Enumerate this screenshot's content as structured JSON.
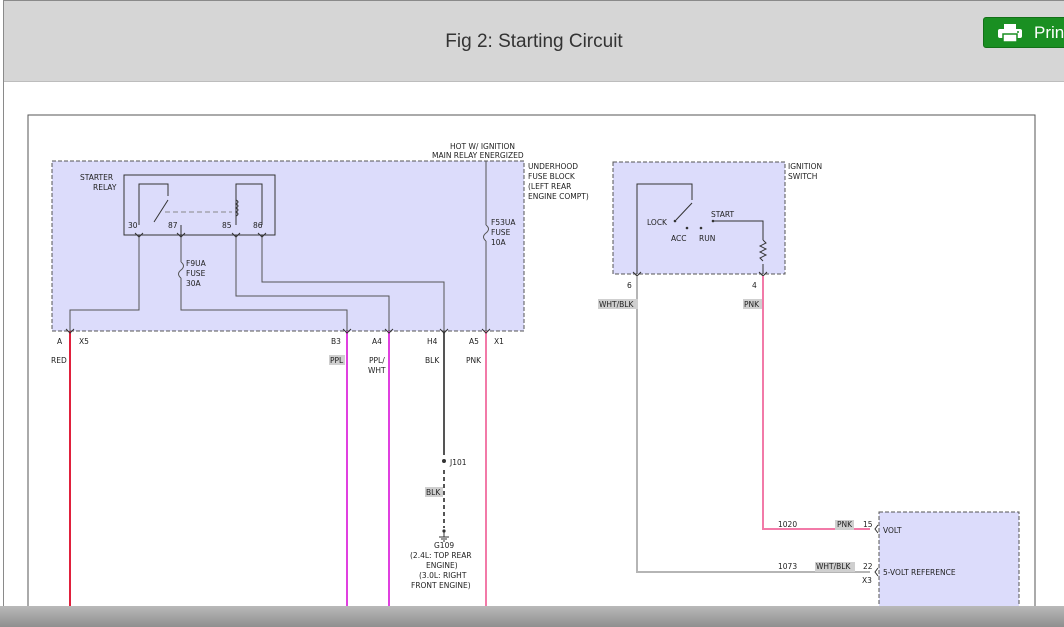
{
  "header": {
    "title": "Fig 2: Starting Circuit",
    "print_label": "Print"
  },
  "diagram": {
    "hot_label_1": "HOT W/ IGNITION",
    "hot_label_2": "MAIN RELAY ENERGIZED",
    "fuse_block": [
      "UNDERHOOD",
      "FUSE BLOCK",
      "(LEFT REAR",
      "ENGINE COMPT)"
    ],
    "starter_relay": [
      "STARTER",
      "RELAY"
    ],
    "relay_pins": [
      "30",
      "87",
      "85",
      "86"
    ],
    "fuse_f53": [
      "F53UA",
      "FUSE",
      "10A"
    ],
    "fuse_f9": [
      "F9UA",
      "FUSE",
      "30A"
    ],
    "connectors": {
      "a": "A",
      "x5": "X5",
      "b3": "B3",
      "a4": "A4",
      "h4": "H4",
      "a5": "A5",
      "x1": "X1"
    },
    "wire_colors": {
      "red": "RED",
      "ppl": "PPL",
      "ppl_wht_1": "PPL/",
      "ppl_wht_2": "WHT",
      "blk": "BLK",
      "pnk": "PNK",
      "blk2": "BLK"
    },
    "splice": "J101",
    "ground": [
      "G109",
      "(2.4L: TOP REAR",
      "ENGINE)",
      "(3.0L: RIGHT",
      "FRONT ENGINE)"
    ],
    "ignition_switch": [
      "IGNITION",
      "SWITCH"
    ],
    "switch_positions": {
      "lock": "LOCK",
      "acc": "ACC",
      "run": "RUN",
      "start": "START"
    },
    "switch_pins": {
      "pin6": "6",
      "pin4": "4"
    },
    "switch_wires": {
      "wht_blk": "WHT/BLK",
      "pnk": "PNK"
    },
    "lower_circuits": [
      {
        "circuit": "1020",
        "color": "PNK",
        "pin": "15",
        "label": "VOLT"
      },
      {
        "circuit": "1073",
        "color": "WHT/BLK",
        "pin": "22",
        "label": "5-VOLT REFERENCE"
      }
    ],
    "module_connector": "X3",
    "colors": {
      "block_fill": "#dcdcfb",
      "red_wire": "#e0203c",
      "ppl_wire": "#e040e0",
      "pnk_wire": "#f27aa8",
      "gray_wire": "#a8a8a8",
      "blk_wire": "#555555"
    }
  }
}
